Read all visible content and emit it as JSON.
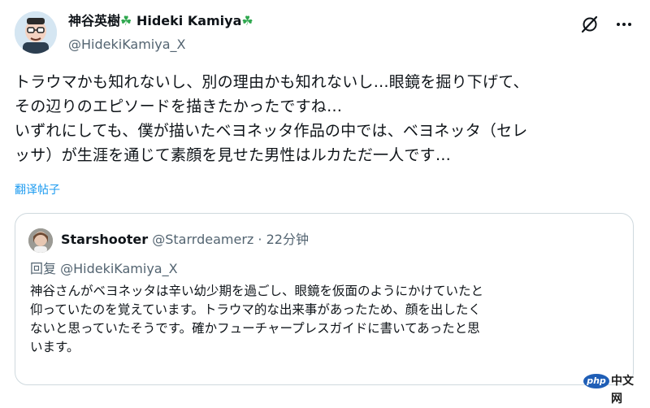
{
  "author": {
    "name": "神谷英樹",
    "name_en": "Hideki Kamiya",
    "clover_glyph": "☘",
    "handle": "@HidekiKamiya_X"
  },
  "top_icons": [
    "grok-icon",
    "more-icon"
  ],
  "tweet": {
    "lines": [
      "トラウマかも知れないし、別の理由かも知れないし…眼鏡を掘り下げて、",
      "その辺りのエピソードを描きたかったですね…",
      "いずれにしても、僕が描いたベヨネッタ作品の中では、ベヨネッタ（セレ",
      "ッサ）が生涯を通じて素顔を見せた男性はルカただ一人です…"
    ],
    "translate_label": "翻译帖子"
  },
  "quote": {
    "name": "Starshooter",
    "handle": "@Starrdeamerz",
    "separator": "·",
    "time": "22分钟",
    "reply_to": "回复 @HidekiKamiya_X",
    "lines": [
      "神谷さんがベヨネッタは辛い幼少期を過ごし、眼鏡を仮面のようにかけていたと",
      "仰っていたのを覚えています。トラウマ的な出来事があったため、顔を出したく",
      "ないと思っていたそうです。確かフューチャープレスガイドに書いてあったと思",
      "います。"
    ]
  },
  "watermark": {
    "logo": "php",
    "text": "中文网"
  },
  "colors": {
    "text": "#0f1419",
    "muted": "#536471",
    "link": "#1d9bf0",
    "border": "#cfd9de",
    "clover": "#2fa84f"
  }
}
